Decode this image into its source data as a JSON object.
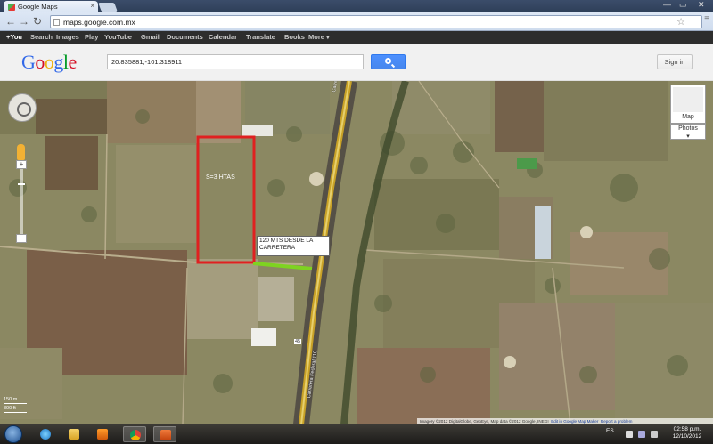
{
  "browser": {
    "tab_title": "Google Maps",
    "tab_close": "×",
    "url": "maps.google.com.mx",
    "back": "←",
    "forward": "→",
    "reload": "↻",
    "star": "☆",
    "wrench": "≡",
    "win_min": "—",
    "win_max": "▭",
    "win_close": "✕"
  },
  "gbar": {
    "links": [
      "+You",
      "Search",
      "Images",
      "Play",
      "YouTube",
      "Gmail",
      "Documents",
      "Calendar",
      "Translate",
      "Books",
      "More ▾"
    ]
  },
  "search": {
    "logo": [
      "G",
      "o",
      "o",
      "g",
      "l",
      "e"
    ],
    "query": "20.835881,-101.318911",
    "sign_in": "Sign in"
  },
  "map": {
    "parcel_label": "S=3 HTAS",
    "distance_label_line1": "120 MTS DESDE LA",
    "distance_label_line2": "CARRETERA",
    "zoom_in": "+",
    "zoom_out": "−",
    "map_type": "Map",
    "photos": "Photos",
    "photos_caret": "▾",
    "scale_metric": "150 m",
    "scale_imperial": "300 ft",
    "road_label_1": "Carretera Federal 110",
    "road_label_2": "Carretera Federal 110",
    "road_shield": "45",
    "attribution_text": "Imagery ©2012 DigitalGlobe, GeoEye, Map data ©2012 Google, INEGI",
    "attribution_link1": "Edit in Google Map Maker",
    "attribution_link2": "Report a problem",
    "colors": {
      "parcel_outline": "#e02020",
      "distance_line": "#7ed321",
      "highway": "#c9a227"
    }
  },
  "taskbar": {
    "language": "ES",
    "time": "02:58 p.m.",
    "date": "12/10/2012",
    "apps": [
      "ie-icon",
      "explorer-icon",
      "media-player-icon",
      "chrome-icon",
      "powerpoint-icon"
    ]
  }
}
